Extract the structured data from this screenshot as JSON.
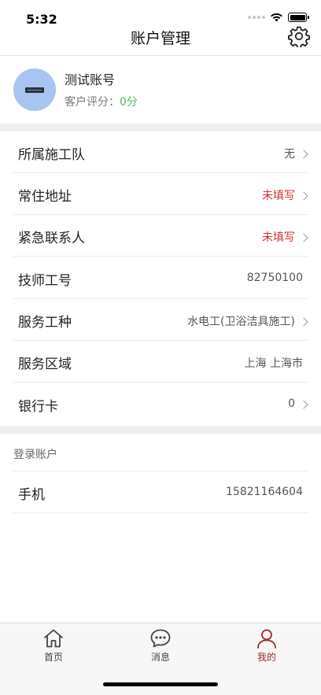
{
  "status_bar": {
    "time": "5:32"
  },
  "nav": {
    "title": "账户管理"
  },
  "profile": {
    "name": "测试账号",
    "score_label": "客户评分：",
    "score_value": "0分"
  },
  "rows": [
    {
      "label": "所属施工队",
      "value": "无",
      "value_color": "#555555",
      "arrow": true
    },
    {
      "label": "常住地址",
      "value": "未填写",
      "value_color": "#d0312d",
      "arrow": true
    },
    {
      "label": "紧急联系人",
      "value": "未填写",
      "value_color": "#d0312d",
      "arrow": true
    },
    {
      "label": "技师工号",
      "value": "82750100",
      "value_color": "#555555",
      "arrow": false
    },
    {
      "label": "服务工种",
      "value": "水电工(卫浴洁具施工)",
      "value_color": "#555555",
      "arrow": true
    },
    {
      "label": "服务区域",
      "value": "上海 上海市",
      "value_color": "#555555",
      "arrow": false
    },
    {
      "label": "银行卡",
      "value": "0",
      "value_color": "#555555",
      "arrow": true
    }
  ],
  "login_section": {
    "header": "登录账户",
    "phone_label": "手机",
    "phone_value": "15821164604"
  },
  "tabs": [
    {
      "label": "首页",
      "icon": "home-icon",
      "active": false
    },
    {
      "label": "消息",
      "icon": "message-icon",
      "active": false
    },
    {
      "label": "我的",
      "icon": "person-icon",
      "active": true
    }
  ],
  "colors": {
    "accent": "#9b2b2b",
    "warning": "#d0312d",
    "score": "#5cb85c"
  }
}
